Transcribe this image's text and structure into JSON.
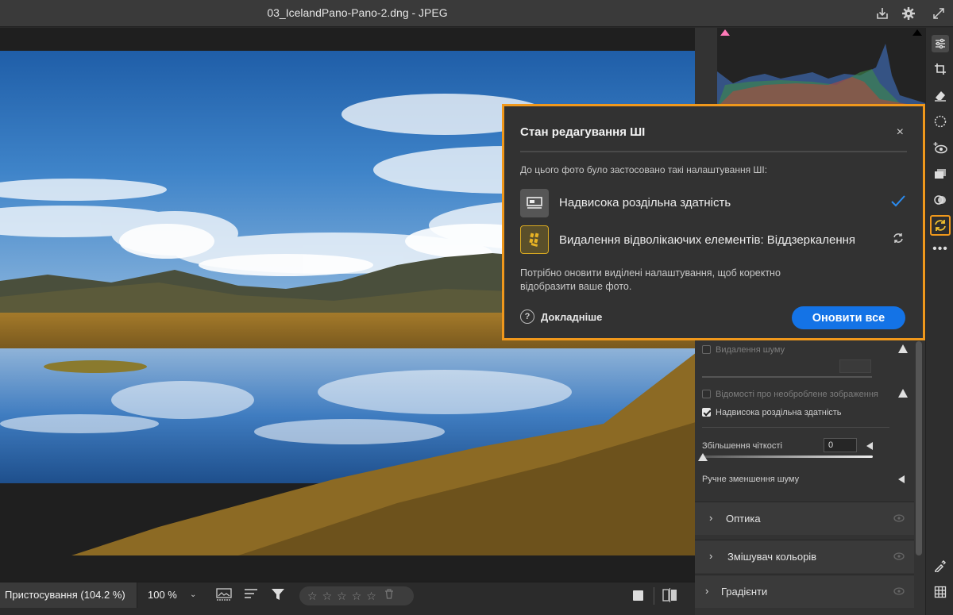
{
  "titlebar": {
    "title": "03_IcelandPano-Pano-2.dng  -  JPEG",
    "icons": [
      "save-icon",
      "gear-icon",
      "fullscreen-icon"
    ]
  },
  "panel": {
    "noise_removal": "Видалення шуму",
    "raw_details": "Відомості про необроблене зображення",
    "super_resolution": "Надвисока роздільна здатність",
    "sharpness_label": "Збільшення чіткості",
    "sharpness_value": "0",
    "manual_noise": "Ручне зменшення шуму",
    "sections": [
      "Оптика",
      "Змішувач кольорів",
      "Градієнти"
    ]
  },
  "toolstrip": {
    "tools": [
      "edit-sliders-icon",
      "crop-icon",
      "eraser-icon",
      "masking-icon",
      "redeye-icon",
      "presets-icon",
      "color-circle-icon",
      "ai-update-icon",
      "more-icon",
      "eyedropper-icon",
      "grid-icon"
    ],
    "active": "ai-update-icon"
  },
  "bottombar": {
    "fit_label": "Пристосування (104.2 %)",
    "zoom_label": "100 %",
    "rating": 0
  },
  "dialog": {
    "title": "Стан редагування ШІ",
    "close_label": "×",
    "subtitle": "До цього фото було застосовано такі налаштування ШІ:",
    "items": [
      {
        "label": "Надвисока роздільна здатність",
        "status": "ok"
      },
      {
        "label": "Видалення відволікаючих елементів: Віддзеркалення",
        "status": "needs-update"
      }
    ],
    "note": "Потрібно оновити виділені налаштування, щоб коректно відобразити ваше фото.",
    "help_label": "Докладніше",
    "update_button": "Оновити все"
  },
  "colors": {
    "accent_orange": "#f0981c",
    "button_blue": "#1473e6",
    "check_blue": "#2b8cf0"
  }
}
